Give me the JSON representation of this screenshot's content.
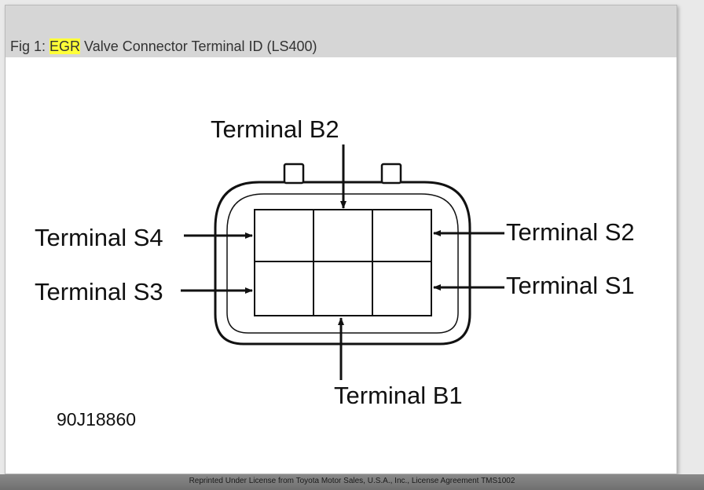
{
  "caption": {
    "prefix": "Fig 1: ",
    "highlight": "EGR",
    "rest": " Valve Connector Terminal ID (LS400)"
  },
  "diagram": {
    "terminals": {
      "b2": "Terminal B2",
      "s4": "Terminal S4",
      "s3": "Terminal S3",
      "s2": "Terminal S2",
      "s1": "Terminal S1",
      "b1": "Terminal B1"
    },
    "figure_code": "90J18860"
  },
  "footer": {
    "text": "Reprinted Under License from Toyota Motor Sales, U.S.A., Inc., License Agreement TMS1002"
  },
  "colors": {
    "highlight": "#ffff38",
    "caption_bar": "#d6d6d6"
  }
}
